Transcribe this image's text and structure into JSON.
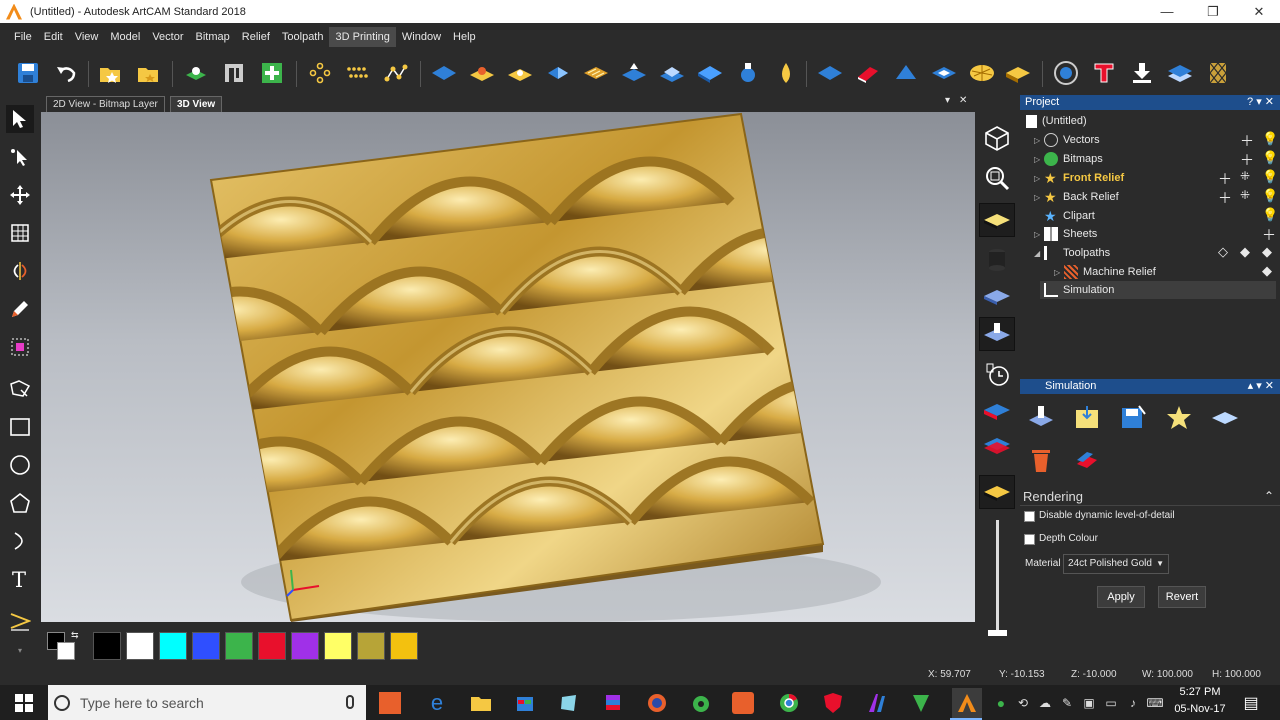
{
  "window": {
    "title": "(Untitled) - Autodesk ArtCAM Standard 2018",
    "minimize": "—",
    "maximize": "❐",
    "close": "✕"
  },
  "menu": [
    "File",
    "Edit",
    "View",
    "Model",
    "Vector",
    "Bitmap",
    "Relief",
    "Toolpath",
    "3D Printing",
    "Window",
    "Help"
  ],
  "menu_active": "3D Printing",
  "view_tabs": {
    "tab1": "2D View - Bitmap Layer",
    "tab2": "3D View",
    "pin": "▾",
    "close": "✕"
  },
  "palette": {
    "colors": [
      "#000000",
      "#ffffff",
      "#00ffff",
      "#2f4fff",
      "#3cb44b",
      "#e8102c",
      "#a030e8",
      "#ffff66",
      "#b7a437",
      "#f3c10f"
    ],
    "primary": "#000000",
    "secondary": "#ffffff"
  },
  "status": {
    "x": "X: 59.707",
    "y": "Y: -10.153",
    "z": "Z: -10.000",
    "w": "W: 100.000",
    "h": "H: 100.000"
  },
  "project": {
    "header": "Project",
    "header_icons": "? ▾ ✕",
    "root": "(Untitled)",
    "items": [
      {
        "label": "Vectors",
        "bold": false
      },
      {
        "label": "Bitmaps",
        "bold": false
      },
      {
        "label": "Front Relief",
        "bold": true
      },
      {
        "label": "Back Relief",
        "bold": false
      },
      {
        "label": "Clipart",
        "bold": false
      },
      {
        "label": "Sheets",
        "bold": false
      },
      {
        "label": "Toolpaths",
        "bold": false
      },
      {
        "label": "Machine Relief",
        "bold": false
      },
      {
        "label": "Simulation",
        "bold": false
      }
    ],
    "selected": "Simulation"
  },
  "simulation": {
    "header": "Simulation"
  },
  "rendering": {
    "header": "Rendering",
    "disable_lod_label": "Disable dynamic level-of-detail",
    "depth_colour_label": "Depth Colour",
    "material_label": "Material",
    "material_value": "24ct Polished Gold",
    "apply": "Apply",
    "revert": "Revert"
  },
  "taskbar": {
    "search_placeholder": "Type here to search",
    "time": "5:27 PM",
    "date": "05-Nov-17"
  },
  "colors": {
    "accent": "#1e4e8c",
    "gold": "#c9a03a",
    "bg": "#2b2b2b"
  }
}
